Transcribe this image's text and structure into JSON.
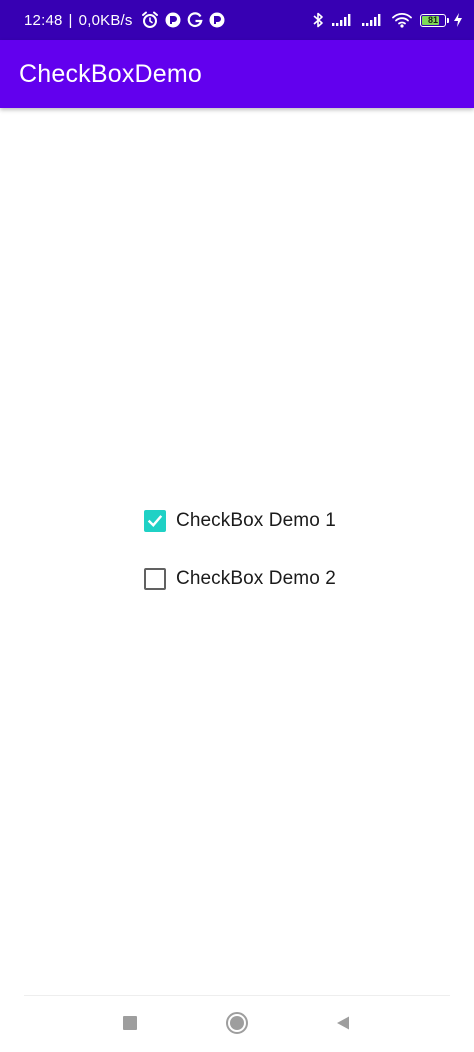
{
  "status_bar": {
    "time": "12:48",
    "separator": "|",
    "network_speed": "0,0KB/s",
    "icons_left": [
      "alarm-icon",
      "notification-icon",
      "google-icon",
      "notification-icon"
    ],
    "icons_right": [
      "bluetooth-icon",
      "signal-icon",
      "signal-icon",
      "wifi-icon",
      "battery-icon",
      "charging-icon"
    ],
    "battery_level": "81",
    "battery_fraction": 0.81,
    "battery_color": "#7ed957"
  },
  "app_bar": {
    "title": "CheckBoxDemo",
    "color": "#6200ee"
  },
  "checkboxes": [
    {
      "label": "CheckBox Demo 1",
      "checked": true
    },
    {
      "label": "CheckBox Demo 2",
      "checked": false
    }
  ],
  "accent_color": "#1fd1c5",
  "status_bar_color": "#3700b3",
  "nav_bar": {
    "buttons": [
      "recents-icon",
      "home-icon",
      "back-icon"
    ]
  }
}
